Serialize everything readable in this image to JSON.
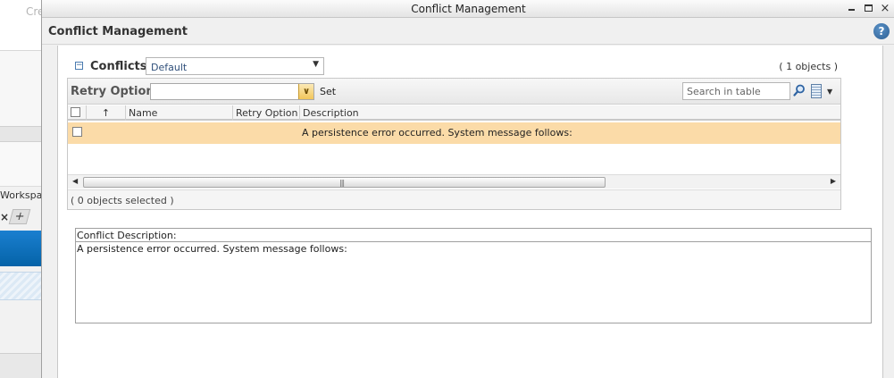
{
  "background_app": {
    "create_label": "Cre",
    "workspace_label": "Workspac",
    "tab_close": "×",
    "tab_add": "+"
  },
  "window": {
    "title": "Conflict Management",
    "controls": {
      "minimize": "",
      "maximize": "",
      "close": "×"
    }
  },
  "page": {
    "title": "Conflict Management",
    "help": "?"
  },
  "conflicts": {
    "collapse_glyph": "−",
    "label": "Conflicts",
    "view_selected": "Default",
    "object_count": "( 1 objects )"
  },
  "toolbar": {
    "retry_option_label": "Retry Option",
    "retry_option_value": "",
    "set_label": "Set",
    "search_placeholder": "Search in table"
  },
  "table": {
    "columns": [
      "",
      "↑",
      "Name",
      "Retry Option",
      "Description"
    ],
    "rows": [
      {
        "message": "A persistence error occurred. System message follows:"
      }
    ],
    "selected_count": "( 0 objects selected )"
  },
  "description": {
    "label": "Conflict Description:",
    "text": "A persistence error occurred. System message follows:"
  },
  "colors": {
    "row_highlight": "#fbdba8",
    "help_blue": "#2d5f93",
    "accent_orange": "#f2c65a"
  }
}
